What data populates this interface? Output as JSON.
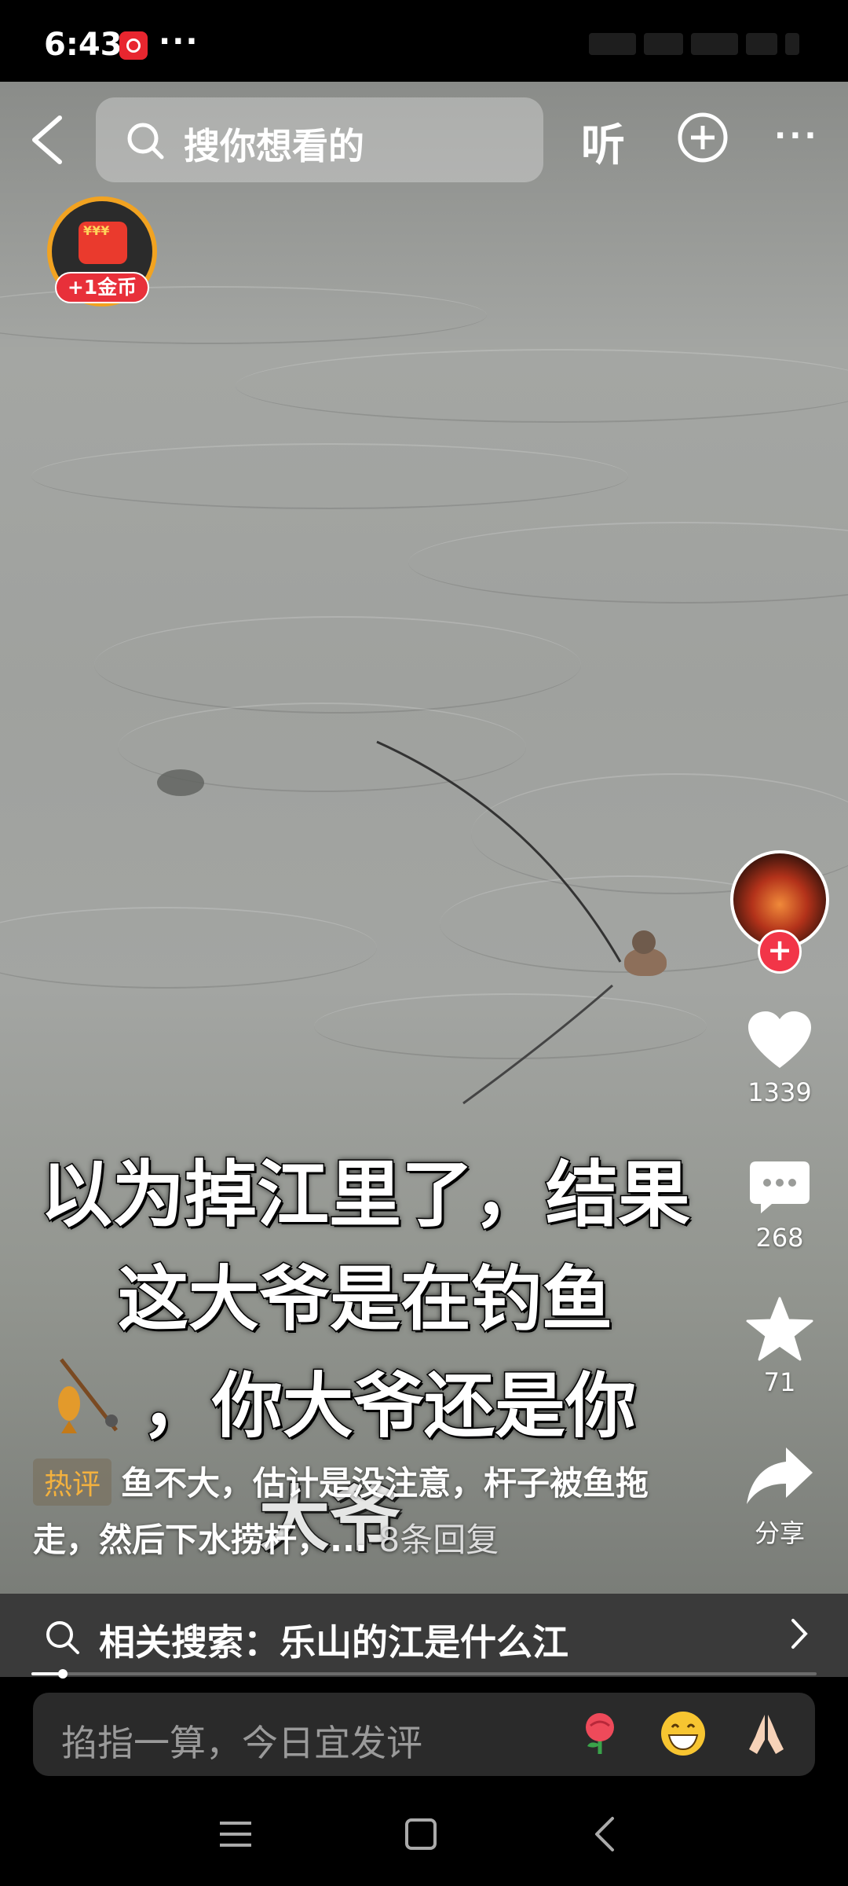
{
  "status_bar": {
    "time": "6:43",
    "dots": "···"
  },
  "header": {
    "search_placeholder": "搜你想看的",
    "listen_label": "听",
    "more_label": "···"
  },
  "coin_widget": {
    "badge_text": "+1金币"
  },
  "actions": {
    "like_count": "1339",
    "comment_count": "268",
    "favorite_count": "71",
    "share_label": "分享"
  },
  "caption": {
    "line1": "以为掉江里了，结果",
    "line2": "这大爷是在钓鱼",
    "line3": "，你大爷还是你",
    "line4": "大爷"
  },
  "hot_comment": {
    "tag": "热评",
    "text": "鱼不大，估计是没注意，杆子被鱼拖走，然后下水捞杆，...",
    "replies": "8条回复"
  },
  "related_search": {
    "label": "相关搜索：乐山的江是什么江"
  },
  "playback": {
    "progress": 0.04
  },
  "comment_input": {
    "placeholder": "掐指一算，今日宜发评"
  },
  "icons": [
    "search-icon",
    "add-icon",
    "heart-icon",
    "comment-icon",
    "star-icon",
    "share-icon",
    "rose-emoji",
    "grin-emoji",
    "pray-emoji",
    "menu-icon",
    "home-icon",
    "back-icon"
  ],
  "colors": {
    "accent_red": "#f23548",
    "coin_orange": "#f2a321",
    "hot_tag": "#f3b13e"
  }
}
